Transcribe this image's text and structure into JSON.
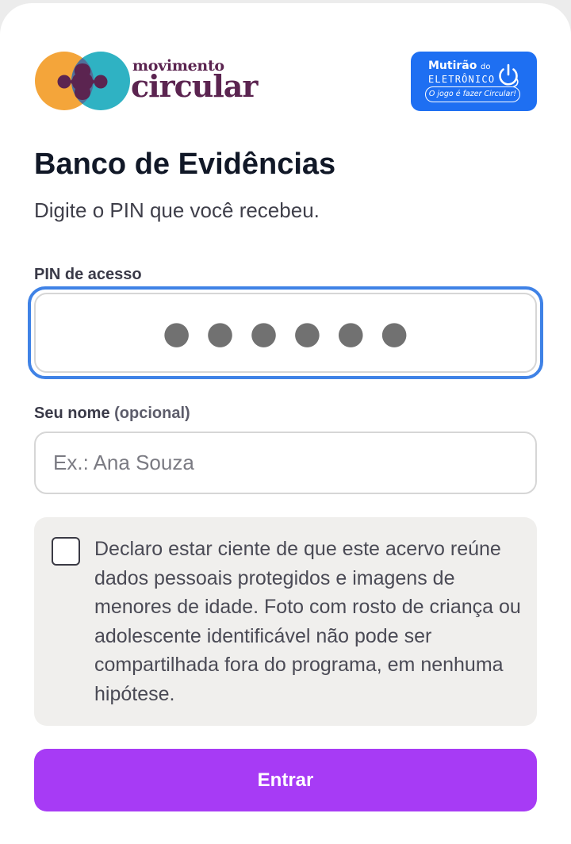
{
  "brand": {
    "name_top": "movimento",
    "name_main": "circular",
    "colors": {
      "orange": "#f4a53a",
      "teal": "#2fb2c3",
      "plum": "#5b2450"
    }
  },
  "badge": {
    "line1": "Mutirão",
    "line1_suffix": "do",
    "line2": "ELETRÔNICO",
    "tagline": "O jogo é fazer Circular!",
    "icon": "power-icon",
    "color": "#1e6ff2"
  },
  "page": {
    "title": "Banco de Evidências",
    "subtitle": "Digite o PIN que você recebeu."
  },
  "pin": {
    "label": "PIN de acesso",
    "value": "●●●●●●"
  },
  "name": {
    "label": "Seu nome",
    "label_optional": "(opcional)",
    "placeholder": "Ex.: Ana Souza",
    "value": ""
  },
  "consent": {
    "checked": false,
    "text": "Declaro estar ciente de que este acervo reúne dados pessoais protegidos e imagens de menores de idade. Foto com rosto de criança ou adolescente identificável não pode ser compartilhada fora do programa, em nenhuma hipótese."
  },
  "submit": {
    "label": "Entrar",
    "color": "#a73bf5"
  },
  "focus_ring_color": "#3f82e6"
}
